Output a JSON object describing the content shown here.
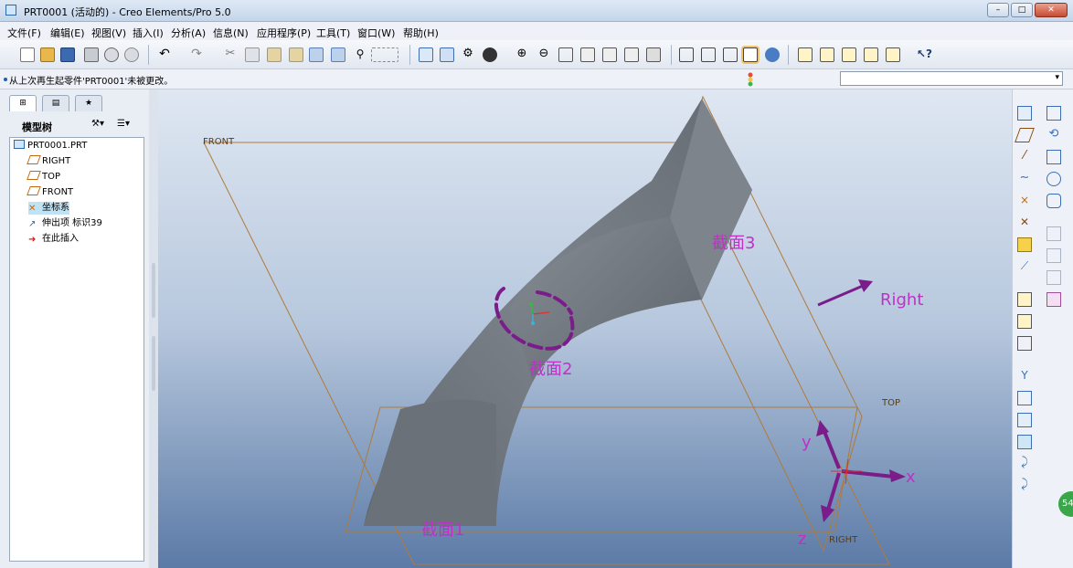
{
  "window": {
    "title": "PRT0001 (活动的) - Creo Elements/Pro 5.0",
    "buttons": {
      "minimize": "–",
      "maximize": "□",
      "close": "✕"
    }
  },
  "menu": [
    "文件(F)",
    "编辑(E)",
    "视图(V)",
    "插入(I)",
    "分析(A)",
    "信息(N)",
    "应用程序(P)",
    "工具(T)",
    "窗口(W)",
    "帮助(H)"
  ],
  "status": {
    "message": "从上次再生起零件'PRT0001'未被更改。",
    "filter_value": ""
  },
  "model_tree": {
    "header": "模型树",
    "root": "PRT0001.PRT",
    "items": [
      "RIGHT",
      "TOP",
      "FRONT",
      "坐标系",
      "伸出项 标识39",
      "在此插入"
    ]
  },
  "viewport": {
    "plane_labels": {
      "front": "FRONT",
      "top": "TOP",
      "right": "RIGHT"
    },
    "annotations": {
      "section1": "截面1",
      "section2": "截面2",
      "section3": "截面3",
      "right_arrow": "Right",
      "axis_x": "x",
      "axis_y": "y",
      "axis_z": "z"
    },
    "corner_badge": "54"
  },
  "colors": {
    "annotation": "#c030c8",
    "arrow": "#7a1d8a",
    "plane": "#b07a3a",
    "model": "#6f767f"
  }
}
